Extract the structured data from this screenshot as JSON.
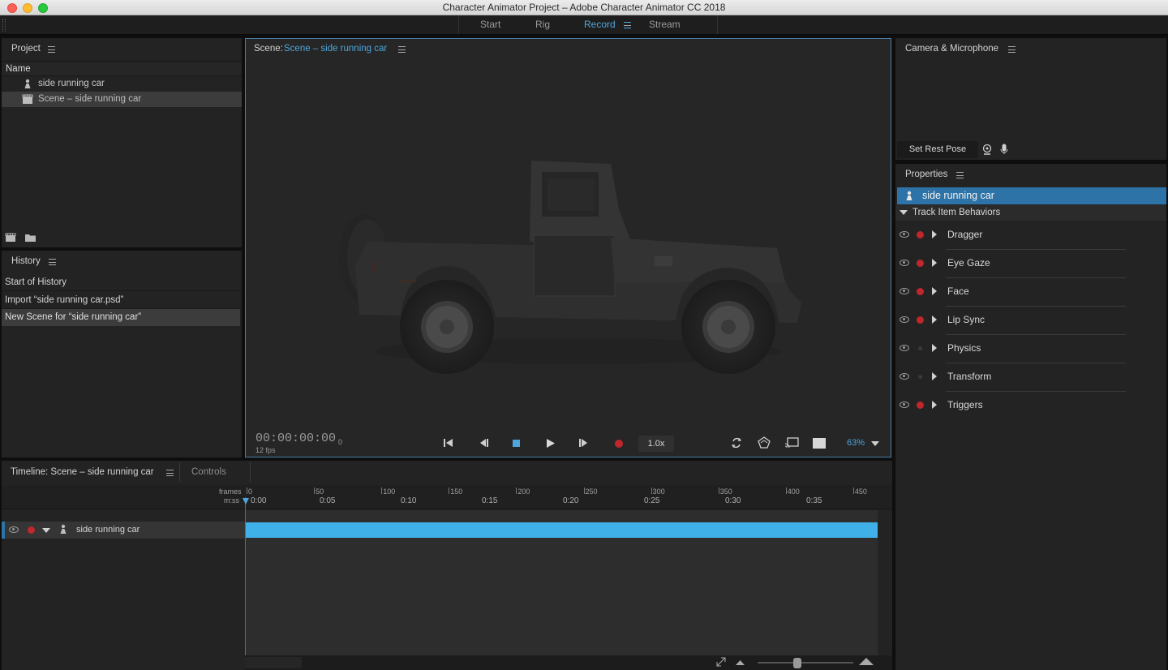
{
  "window": {
    "title": "Character Animator Project – Adobe Character Animator CC 2018"
  },
  "workspace_tabs": [
    {
      "label": "Start"
    },
    {
      "label": "Rig"
    },
    {
      "label": "Record"
    },
    {
      "label": "Stream"
    }
  ],
  "project": {
    "title": "Project",
    "column_name": "Name",
    "items": [
      {
        "label": "side running car",
        "icon": "puppet-icon"
      },
      {
        "label": "Scene – side running car",
        "icon": "clapperboard-icon"
      }
    ]
  },
  "history": {
    "title": "History",
    "items": [
      "Start of History",
      "Import “side running car.psd”",
      "New Scene for “side running car”"
    ]
  },
  "scene": {
    "prefix": "Scene:",
    "name": "Scene – side running car",
    "timecode": "00:00:00:00",
    "frame": "0",
    "fps": "12 fps",
    "speed": "1.0x",
    "zoom": "63%"
  },
  "camera": {
    "title": "Camera & Microphone",
    "rest_pose_label": "Set Rest Pose"
  },
  "properties": {
    "title": "Properties",
    "selected": "side running car",
    "section": "Track Item Behaviors",
    "behaviors": [
      {
        "label": "Dragger",
        "armed": true
      },
      {
        "label": "Eye Gaze",
        "armed": true
      },
      {
        "label": "Face",
        "armed": true
      },
      {
        "label": "Lip Sync",
        "armed": true
      },
      {
        "label": "Physics",
        "armed": false
      },
      {
        "label": "Transform",
        "armed": false
      },
      {
        "label": "Triggers",
        "armed": true
      }
    ]
  },
  "timeline": {
    "title": "Timeline: Scene – side running car",
    "controls_tab": "Controls",
    "frames_label": "frames",
    "mss_label": "m:ss",
    "frame_ticks": [
      "0",
      "50",
      "100",
      "150",
      "200",
      "250",
      "300",
      "350",
      "400",
      "450"
    ],
    "time_ticks": [
      "0:00",
      "0:05",
      "0:10",
      "0:15",
      "0:20",
      "0:25",
      "0:30",
      "0:35"
    ],
    "track_label": "side running car"
  },
  "colors": {
    "accent": "#4ea6dc",
    "track_bar": "#3fb1e8",
    "record_red": "#c0272d",
    "selection_blue": "#2e73a8"
  }
}
